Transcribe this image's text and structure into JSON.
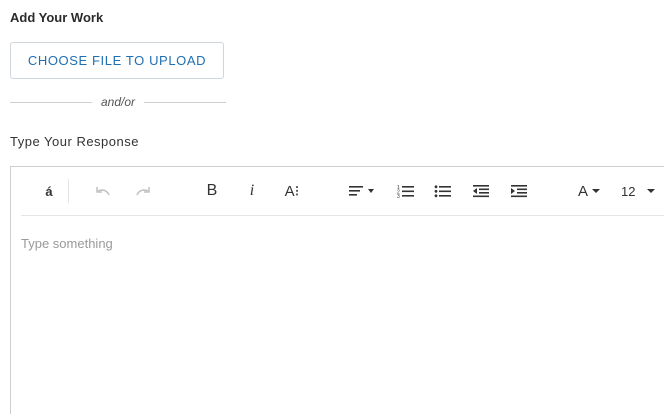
{
  "section": {
    "title": "Add Your Work"
  },
  "upload": {
    "button_label": "CHOOSE FILE TO UPLOAD"
  },
  "divider": {
    "text": "and/or"
  },
  "response": {
    "label": "Type Your Response"
  },
  "editor": {
    "placeholder": "Type something",
    "toolbar": {
      "special_char": "á",
      "font_size_value": "12",
      "icons": [
        "special-characters-icon",
        "undo-icon",
        "redo-icon",
        "bold-icon",
        "italic-icon",
        "text-style-icon",
        "align-dropdown-icon",
        "numbered-list-icon",
        "bulleted-list-icon",
        "outdent-icon",
        "indent-icon",
        "font-color-icon",
        "font-size-dropdown"
      ]
    }
  }
}
